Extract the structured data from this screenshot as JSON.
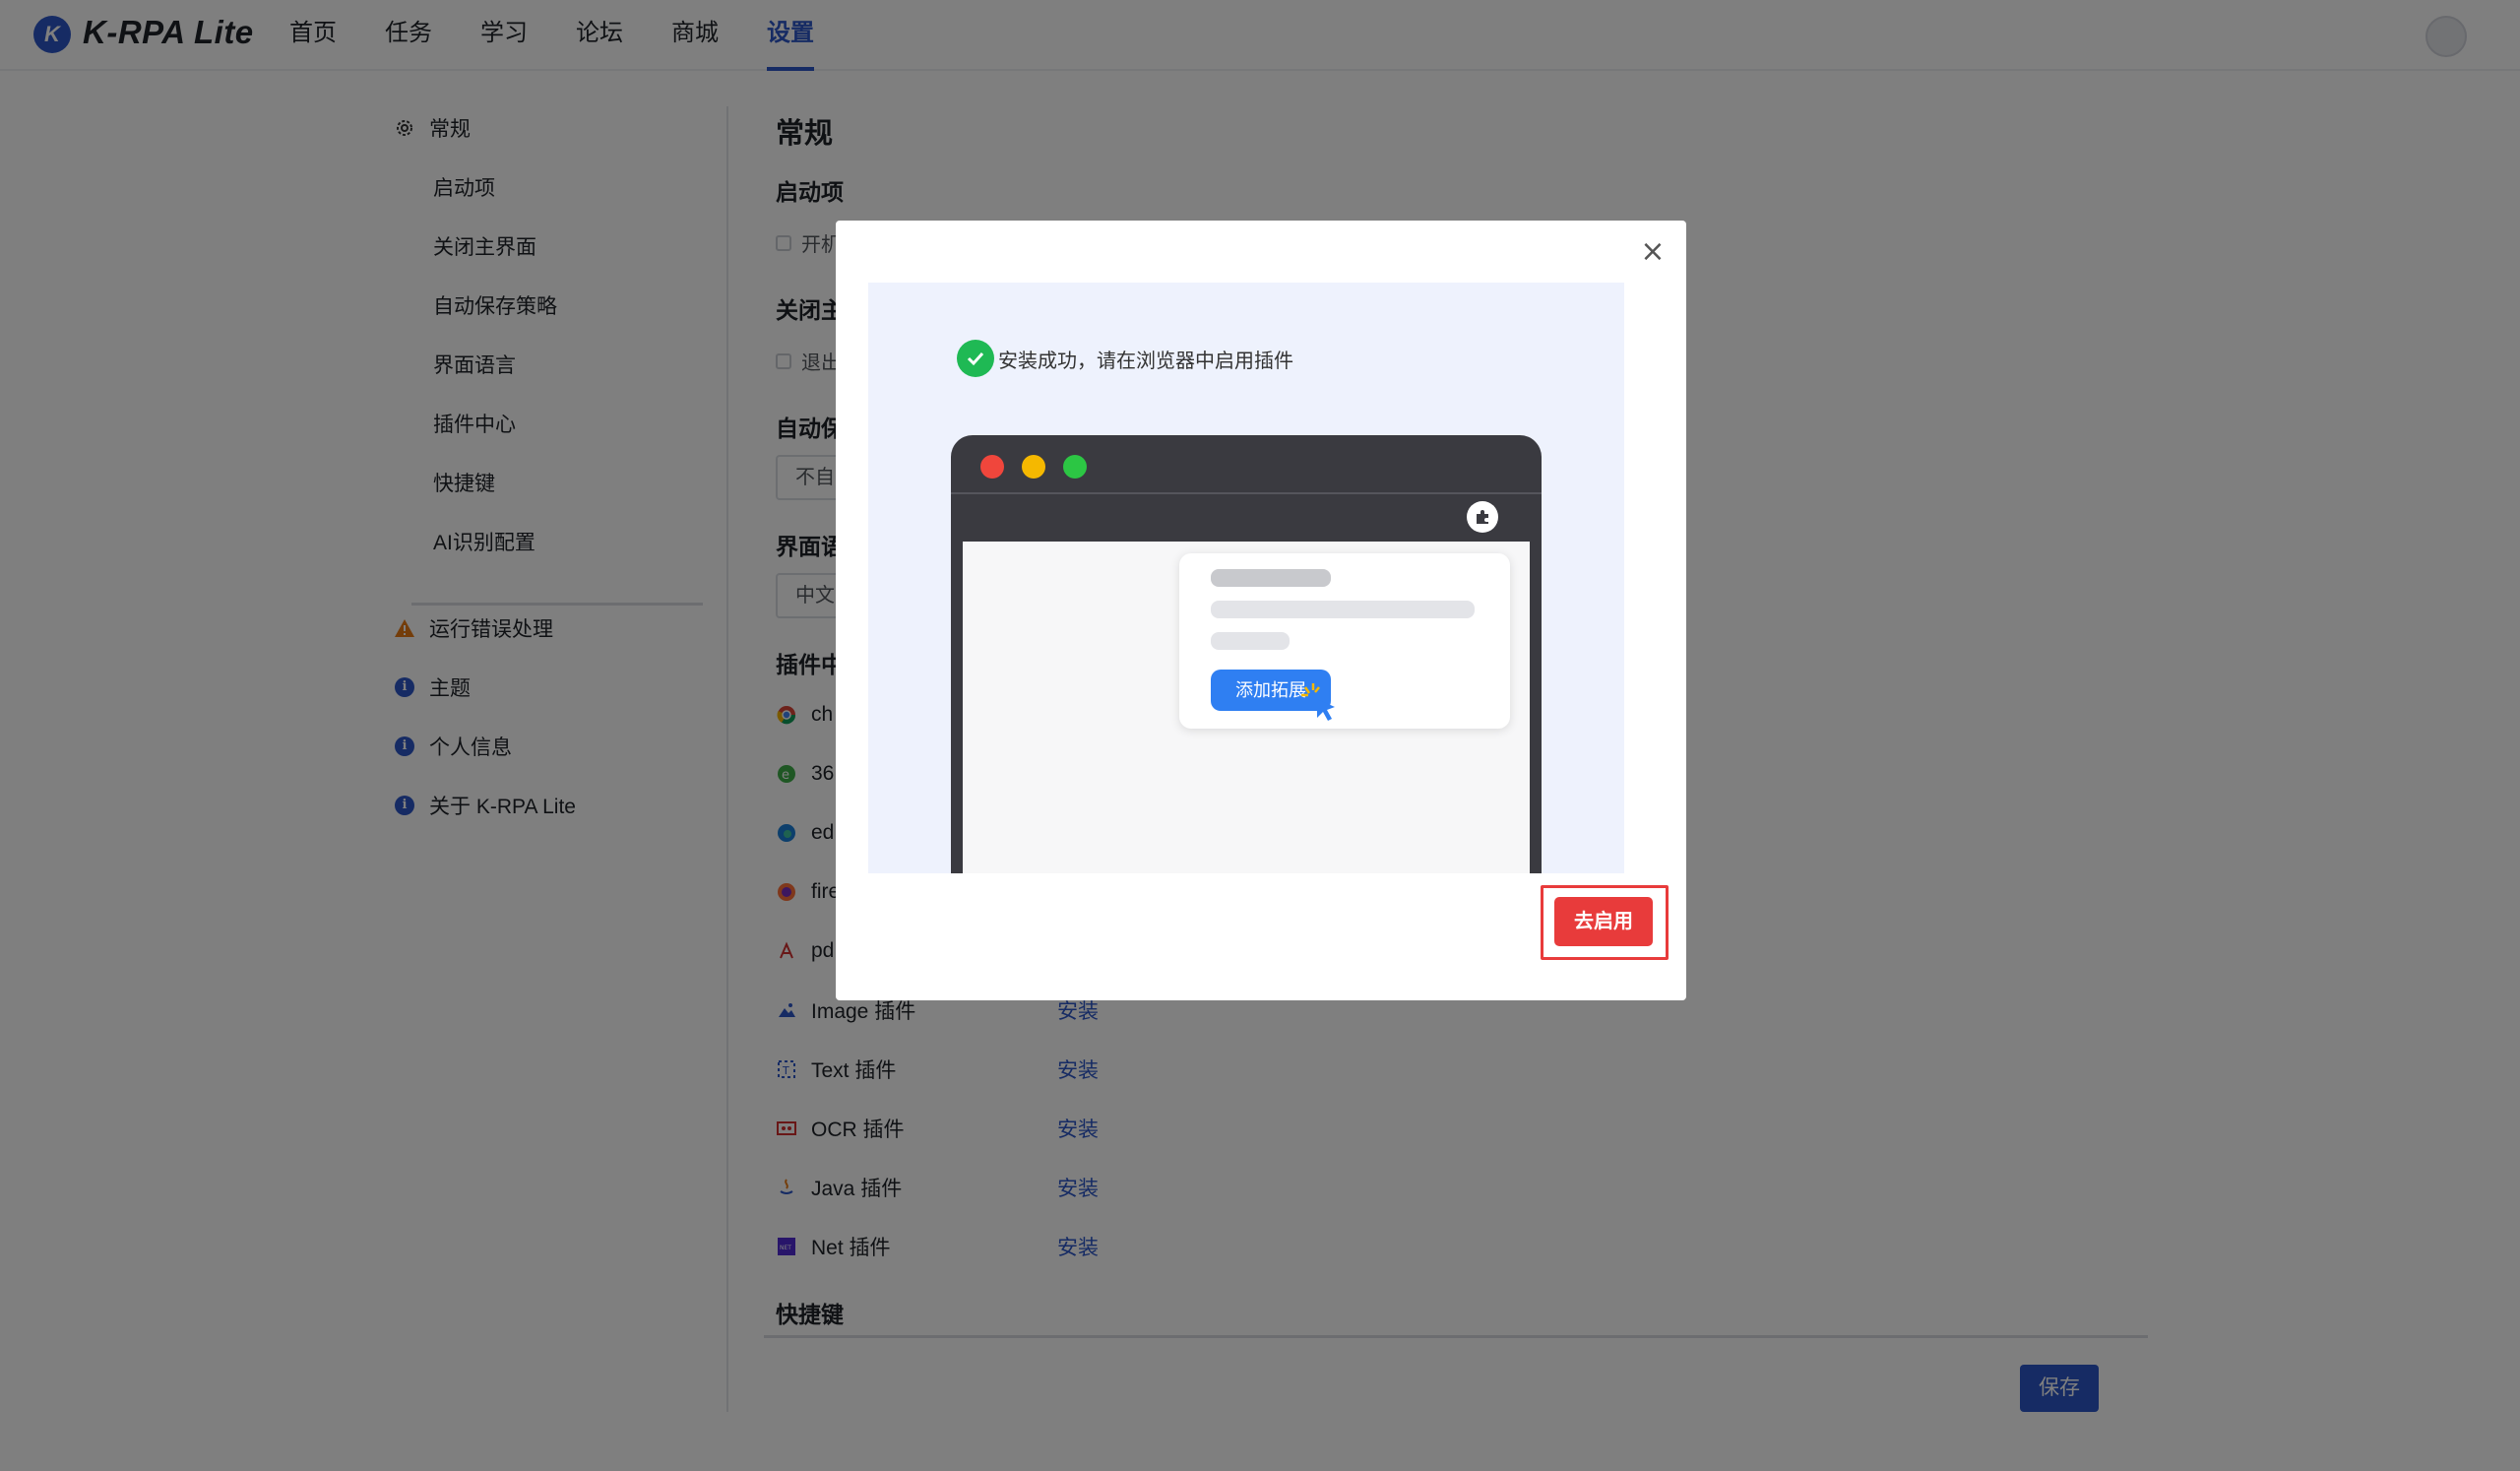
{
  "app": {
    "logo_letter": "K",
    "brand": "K-RPA Lite",
    "nav": [
      "首页",
      "任务",
      "学习",
      "论坛",
      "商城",
      "设置"
    ],
    "nav_active": "设置"
  },
  "sidebar": {
    "items": [
      {
        "label": "常规",
        "icon": "gear-icon"
      },
      {
        "label": "启动项"
      },
      {
        "label": "关闭主界面"
      },
      {
        "label": "自动保存策略"
      },
      {
        "label": "界面语言"
      },
      {
        "label": "插件中心"
      },
      {
        "label": "快捷键"
      },
      {
        "label": "AI识别配置"
      },
      {
        "label": "运行错误处理",
        "icon": "warning-icon"
      },
      {
        "label": "主题",
        "icon": "info-icon"
      },
      {
        "label": "个人信息",
        "icon": "info-icon"
      },
      {
        "label": "关于 K-RPA Lite",
        "icon": "info-icon"
      }
    ]
  },
  "main": {
    "title": "常规",
    "sections": {
      "startup": "启动项",
      "startup_option": "开机",
      "close_main": "关闭主",
      "close_option": "退出",
      "autosave": "自动保",
      "autosave_value": "不自",
      "language": "界面语",
      "language_value": "中文",
      "plugins": "插件中",
      "shortcuts": "快捷键"
    },
    "plugins": [
      {
        "name": "ch",
        "icon": "chrome-icon",
        "action": ""
      },
      {
        "name": "36",
        "icon": "360-browser-icon",
        "action": ""
      },
      {
        "name": "ed",
        "icon": "edge-icon",
        "action": ""
      },
      {
        "name": "fire",
        "icon": "firefox-icon",
        "action": ""
      },
      {
        "name": "pd",
        "icon": "pdf-icon",
        "action": ""
      },
      {
        "name": "Image 插件",
        "icon": "image-icon",
        "action": "安装"
      },
      {
        "name": "Text 插件",
        "icon": "text-icon",
        "action": "安装"
      },
      {
        "name": "OCR 插件",
        "icon": "ocr-icon",
        "action": "安装"
      },
      {
        "name": "Java 插件",
        "icon": "java-icon",
        "action": "安装"
      },
      {
        "name": "Net 插件",
        "icon": "dotnet-icon",
        "action": "安装"
      }
    ],
    "save_label": "保存"
  },
  "modal": {
    "success_text": "安装成功，请在浏览器中启用插件",
    "add_extension_label": "添加拓展",
    "go_enable_label": "去启用"
  },
  "colors": {
    "primary": "#2c57c8",
    "danger": "#e83b3b",
    "success": "#1fb954"
  }
}
